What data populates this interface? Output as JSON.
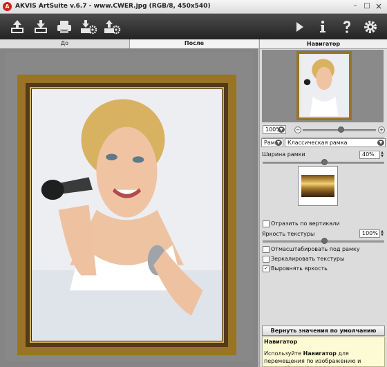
{
  "window": {
    "title": "AKVIS ArtSuite v.6.7 - www.CWER.jpg (RGB/8, 450x540)",
    "minimize": "–",
    "maximize": "□",
    "close": "×"
  },
  "toolbar": {
    "buttons": [
      "open-icon",
      "save-icon",
      "print-icon",
      "import-settings-icon",
      "export-settings-icon",
      "run-icon",
      "info-icon",
      "help-icon",
      "preferences-icon"
    ]
  },
  "tabs": {
    "before": "До",
    "after": "После"
  },
  "navigator": {
    "title": "Навигатор",
    "zoom": "100%"
  },
  "settings": {
    "category": "Рамки",
    "frame_type": "Классическая рамка",
    "frame_width_label": "Ширина рамки",
    "frame_width_value": "40%",
    "frame_width_level": 0.5,
    "flip_vertical_label": "Отразить по вертикали",
    "flip_vertical_checked": false,
    "texture_brightness_label": "Яркость текстуры",
    "texture_brightness_value": "100%",
    "texture_brightness_level": 0.5,
    "scale_to_frame_label": "Отмасштабировать под рамку",
    "scale_to_frame_checked": false,
    "mirror_textures_label": "Зеркалировать текстуры",
    "mirror_textures_checked": false,
    "equalize_brightness_label": "Выровнять яркость",
    "equalize_brightness_checked": true
  },
  "reset_button": "Вернуть значения по умолчанию",
  "help": {
    "title": "Навигатор",
    "text_before": "Используйте ",
    "text_bold": "Навигатор",
    "text_after": " для перемещения по изображению и масштабирования. Рамку можно"
  },
  "colors": {
    "frame_gold": "#9a7425",
    "toolbar_dark": "#2b2b2b",
    "help_bg": "#fdfbd4"
  }
}
